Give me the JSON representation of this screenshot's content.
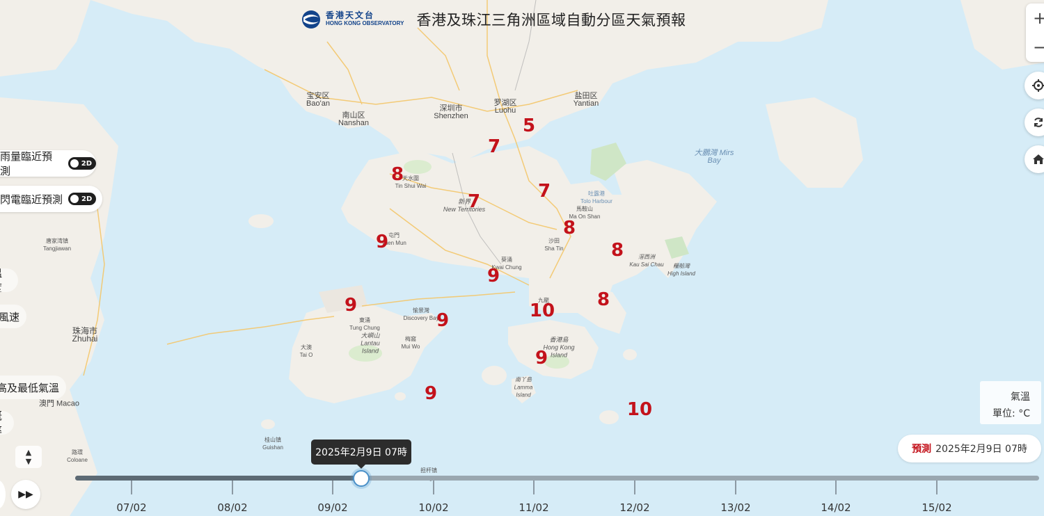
{
  "header": {
    "logo_zh": "香港天文台",
    "logo_en": "HONG KONG OBSERVATORY",
    "title": "香港及珠江三角洲區域自動分區天氣預報"
  },
  "left_panel": {
    "rain_nowcast": "雨量臨近預測",
    "lightning_nowcast": "閃電臨近預測",
    "toggle_label": "2D",
    "chip_temp": "溫度",
    "chip_wind": "風速",
    "chip_maxmin": "最高及最低氣溫",
    "chip_prob": "概率"
  },
  "legend": {
    "title": "氣溫",
    "unit": "單位: °C"
  },
  "forecast": {
    "label": "預測",
    "datetime": "2025年2月9日 07時"
  },
  "timeline": {
    "tooltip": "2025年2月9日 07時",
    "position_fraction": 0.296,
    "days": [
      "07/02",
      "08/02",
      "09/02",
      "10/02",
      "11/02",
      "12/02",
      "13/02",
      "14/02",
      "15/02"
    ]
  },
  "temperatures": [
    "5",
    "7",
    "8",
    "7",
    "7",
    "9",
    "8",
    "8",
    "9",
    "9",
    "9",
    "10",
    "8",
    "9",
    "9",
    "10"
  ],
  "places": {
    "baoan": "宝安区",
    "baoan_en": "Bao'an",
    "nanshan": "南山区",
    "nanshan_en": "Nanshan",
    "shenzhen": "深圳市",
    "shenzhen_en": "Shenzhen",
    "luohu": "罗湖区",
    "luohu_en": "Luohu",
    "yantian": "盐田区",
    "yantian_en": "Yantian",
    "mirs_bay": "大鵬灣 Mirs Bay",
    "tin_shui_wai": "天水圍",
    "tin_shui_wai_en": "Tin Shui Wai",
    "new_territories": "新界",
    "new_territories_en": "New Territories",
    "tuen_mun": "屯門",
    "tuen_mun_en": "Tuen Mun",
    "tolo": "吐露港",
    "tolo_en": "Tolo Harbour",
    "ma_on_shan": "馬鞍山",
    "ma_on_shan_en": "Ma On Shan",
    "sha_tin": "沙田",
    "sha_tin_en": "Sha Tin",
    "kwai_chung": "葵涌",
    "kwai_chung_en": "Kwai Chung",
    "kau_sai_chau": "滘西洲",
    "kau_sai_chau_en": "Kau Sai Chau",
    "high_island": "糧船灣",
    "high_island_en": "High Island",
    "tangjiawan": "唐家湾镇",
    "tangjiawan_en": "Tangjiawan",
    "zhuhai": "珠海市",
    "zhuhai_en": "Zhuhai",
    "macao": "澳門 Macao",
    "tung_chung": "東涌",
    "tung_chung_en": "Tung Chung",
    "discovery_bay": "愉景灣",
    "discovery_bay_en": "Discovery Bay",
    "lantau": "大嶼山",
    "lantau_en": "Lantau Island",
    "tai_o": "大澳",
    "tai_o_en": "Tai O",
    "mui_wo": "梅窩",
    "mui_wo_en": "Mui Wo",
    "hk_island": "香港島",
    "hk_island_en": "Hong Kong Island",
    "lamma": "南丫島",
    "lamma_en": "Lamma Island",
    "kowloon": "九龍",
    "guishan": "桂山镇",
    "guishan_en": "Guishan",
    "dangan": "担杆镇",
    "dangan_en": "Dangan",
    "coloane": "路環",
    "coloane_en": "Coloane"
  },
  "colors": {
    "sea": "#d6ecf7",
    "land": "#f2efe9",
    "temp_text": "#c3121b",
    "brand": "#12438a"
  }
}
